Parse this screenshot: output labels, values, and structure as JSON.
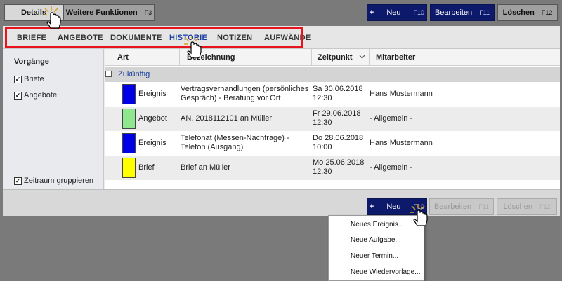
{
  "toolbar_top": {
    "details_label": "Details",
    "weitere_label": "Weitere Funktionen",
    "weitere_shortcut": "F3",
    "neu_plus": "+",
    "neu_label": "Neu",
    "neu_shortcut": "F10",
    "bearbeiten_label": "Bearbeiten",
    "bearbeiten_shortcut": "F11",
    "loeschen_label": "Löschen",
    "loeschen_shortcut": "F12"
  },
  "tabs": [
    "BRIEFE",
    "ANGEBOTE",
    "DOKUMENTE",
    "HISTORIE",
    "NOTIZEN",
    "AUFWÄNDE"
  ],
  "active_tab": "HISTORIE",
  "sidebar": {
    "title": "Vorgänge",
    "checkboxes": [
      {
        "label": "Briefe",
        "checked": true
      },
      {
        "label": "Angebote",
        "checked": true
      }
    ],
    "group_checkbox": {
      "label": "Zeitraum gruppieren",
      "checked": true
    }
  },
  "table": {
    "headers": [
      "Art",
      "Bezeichnung",
      "Zeitpunkt",
      "Mitarbeiter"
    ],
    "group": {
      "toggle": "−",
      "label": "Zukünftig"
    },
    "rows": [
      {
        "color": "#0000e6",
        "art": "Ereignis",
        "bezeichnung": "Vertragsverhandlungen (persönliches Gespräch) - Beratung vor Ort",
        "zeit_datum": "Sa 30.06.2018",
        "zeit_uhr": "12:30",
        "mitarbeiter": "Hans Mustermann"
      },
      {
        "color": "#8fe88f",
        "art": "Angebot",
        "bezeichnung": "AN. 2018112101 an Müller",
        "zeit_datum": "Fr 29.06.2018",
        "zeit_uhr": "12:30",
        "mitarbeiter": "- Allgemein -"
      },
      {
        "color": "#0000e6",
        "art": "Ereignis",
        "bezeichnung": "Telefonat (Messen-Nachfrage) - Telefon (Ausgang)",
        "zeit_datum": "Do 28.06.2018",
        "zeit_uhr": "10:00",
        "mitarbeiter": "Hans Mustermann"
      },
      {
        "color": "#ffff00",
        "art": "Brief",
        "bezeichnung": "Brief an Müller",
        "zeit_datum": "Mo 25.06.2018",
        "zeit_uhr": "12:30",
        "mitarbeiter": "- Allgemein -"
      }
    ]
  },
  "toolbar_bottom": {
    "neu_plus": "+",
    "neu_label": "Neu",
    "neu_shortcut": "F10",
    "bearbeiten_label": "Bearbeiten",
    "bearbeiten_shortcut": "F11",
    "loeschen_label": "Löschen",
    "loeschen_shortcut": "F12"
  },
  "dropdown": [
    "Neues Ereignis...",
    "Neue Aufgabe...",
    "Neuer Termin...",
    "Neue Wiedervorlage..."
  ],
  "colors": {
    "accent_navy": "#0d1a6b",
    "highlight_red": "#e8141c",
    "link_blue": "#1a3fa0"
  }
}
